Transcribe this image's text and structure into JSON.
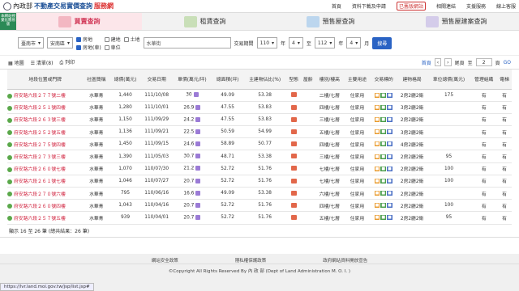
{
  "header": {
    "ministry": "內政部",
    "title": "不動產交易實價查詢",
    "title_suffix": "服務網",
    "nav": [
      "首頁",
      "資料下載及申請",
      "已舊版網站",
      "相關連結",
      "支援服務",
      "線上客服"
    ]
  },
  "side_badge": "本網站視覺化簡易版",
  "tabs": [
    {
      "label": "買賣查詢",
      "active": true
    },
    {
      "label": "租賃查詢",
      "active": false
    },
    {
      "label": "預售屋查詢",
      "active": false
    },
    {
      "label": "預售屋建案查詢",
      "active": false
    }
  ],
  "search": {
    "city": "臺南市",
    "district": "安南區",
    "types": [
      "房地",
      "建地",
      "土地",
      "房地(車)",
      "車位"
    ],
    "address": "水華街",
    "period_label": "交易期間",
    "year_from": "110",
    "year_to": "112",
    "month_from": "4",
    "month_to": "4",
    "year_unit": "年",
    "to_label": "至",
    "month_unit": "月",
    "submit": "搜尋"
  },
  "toolbar": {
    "map": "地圖",
    "list": "清單(8)",
    "print": "列印",
    "first": "首頁",
    "last": "尾頁",
    "to": "至",
    "page": "2",
    "pages": "頁",
    "go": "GO"
  },
  "columns": [
    "地段位置或門牌",
    "社區簡稱",
    "總價(萬元)",
    "交易日期",
    "單價(萬元/坪)",
    "總面積(坪)",
    "主建物佔比(%)",
    "型態",
    "屋齡",
    "樓別/樓高",
    "主要用途",
    "交易標的",
    "建物格局",
    "車位總價(萬元)",
    "管理組織",
    "電梯"
  ],
  "rows": [
    [
      "府安路六段２７７號二樓",
      "水華青",
      "1,440",
      "111/10/08",
      "30",
      "49.09",
      "53.38",
      "",
      "",
      "二樓/七層",
      "住家用",
      "",
      "2房2廳2衛",
      "175",
      "有",
      "有"
    ],
    [
      "府安路六段２５１號四樓",
      "水華青",
      "1,280",
      "111/10/01",
      "26.9",
      "47.55",
      "53.83",
      "",
      "",
      "四樓/七層",
      "住家用",
      "",
      "3房2廳2衛",
      "",
      "有",
      "有"
    ],
    [
      "府安路六段２６３號三樓",
      "水華青",
      "1,150",
      "111/09/29",
      "24.2",
      "47.55",
      "53.83",
      "",
      "",
      "三樓/七層",
      "住家用",
      "",
      "2房2廳2衛",
      "",
      "有",
      "有"
    ],
    [
      "府安路六段２５２號五樓",
      "水華青",
      "1,136",
      "111/09/21",
      "22.5",
      "50.59",
      "54.99",
      "",
      "",
      "五樓/七層",
      "住家用",
      "",
      "3房2廳2衛",
      "",
      "有",
      "有"
    ],
    [
      "府安路六段２７５號四樓",
      "水華青",
      "1,450",
      "111/09/15",
      "24.6",
      "58.89",
      "50.77",
      "",
      "",
      "四樓/七層",
      "住家用",
      "",
      "4房2廳2衛",
      "",
      "有",
      "有"
    ],
    [
      "府安路六段２７３號三樓",
      "水華青",
      "1,390",
      "111/05/03",
      "30.7",
      "48.71",
      "53.38",
      "",
      "",
      "三樓/七層",
      "住家用",
      "",
      "2房2廳2衛",
      "95",
      "有",
      "有"
    ],
    [
      "府安路六段２６０號七樓",
      "水華青",
      "1,070",
      "110/07/30",
      "21.2",
      "52.72",
      "51.76",
      "",
      "",
      "七樓/七層",
      "住家用",
      "",
      "2房2廳2衛",
      "100",
      "有",
      "有"
    ],
    [
      "府安路六段２６１號七樓",
      "水華青",
      "1,046",
      "110/07/27",
      "20.7",
      "52.72",
      "51.76",
      "",
      "",
      "七樓/七層",
      "住家用",
      "",
      "2房2廳2衛",
      "100",
      "有",
      "有"
    ],
    [
      "府安路六段２７０號六樓",
      "水華青",
      "795",
      "110/06/16",
      "16.6",
      "49.09",
      "53.38",
      "",
      "",
      "六樓/七層",
      "住家用",
      "",
      "2房2廳2衛",
      "",
      "有",
      "有"
    ],
    [
      "府安路六段２６０號四樓",
      "水華青",
      "1,043",
      "110/04/16",
      "20.7",
      "52.72",
      "51.76",
      "",
      "",
      "四樓/七層",
      "住家用",
      "",
      "2房2廳2衛",
      "100",
      "有",
      "有"
    ],
    [
      "府安路六段２５７號五樓",
      "水華青",
      "939",
      "110/04/01",
      "20.7",
      "52.72",
      "51.76",
      "",
      "",
      "五樓/七層",
      "住家用",
      "",
      "2房2廳2衛",
      "95",
      "有",
      "有"
    ]
  ],
  "table_footer": "顯示 16 至 26 筆 (總共結果：26 筆)",
  "footer": {
    "links": [
      "網站安全政策",
      "隱私權保護政策",
      "政府網站資料開放宣告"
    ],
    "copyright": "©Copyright All Rights Reserved By 內 政 部 (Dept of Land Administration M. O. I. )"
  },
  "status_url": "https://lvr.land.moi.gov.tw/jsp/list.jsp#",
  "colors": {
    "accent": "#2a63c4",
    "active_tab": "#d23b5a",
    "location_text": "#d0203c"
  }
}
